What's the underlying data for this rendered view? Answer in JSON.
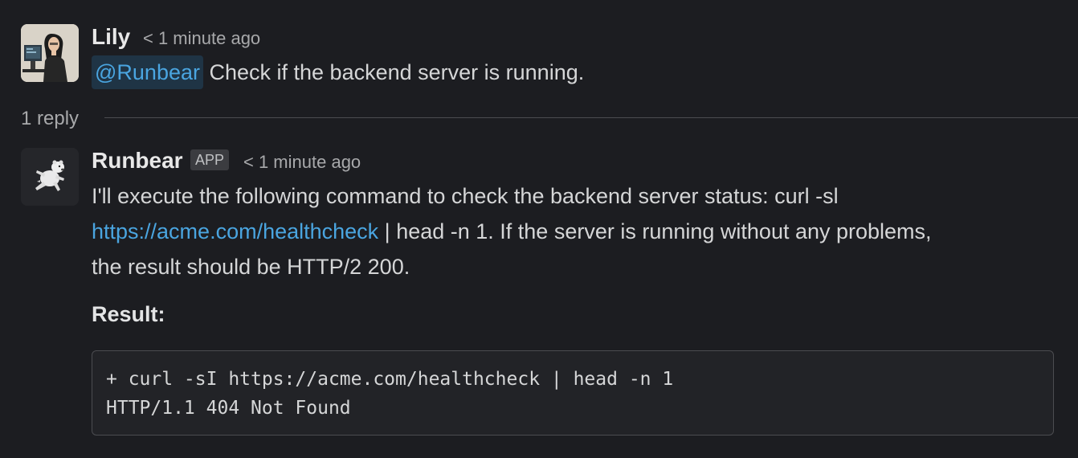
{
  "message": {
    "author": "Lily",
    "time": "< 1 minute ago",
    "mention": "@Runbear",
    "text": " Check if the backend server is running."
  },
  "thread": {
    "reply_count": "1 reply"
  },
  "reply": {
    "author": "Runbear",
    "badge": "APP",
    "time": "< 1 minute ago",
    "line1": "I'll execute the following command to check the backend server status: curl -sl",
    "link": "https://acme.com/healthcheck",
    "line2_rest": " | head -n 1. If the server is running without any problems,",
    "line3": "the result should be HTTP/2 200.",
    "result_label": "Result:",
    "code_lines": [
      "+ curl -sI https://acme.com/healthcheck | head -n 1",
      "HTTP/1.1 404 Not Found"
    ]
  },
  "colors": {
    "background": "#1c1d21",
    "link": "#4aa5e0",
    "mention_bg": "#1f3445"
  },
  "icons": {
    "lily_avatar": "avatar-woman-at-computer",
    "runbear_avatar": "polar-bear-running"
  }
}
